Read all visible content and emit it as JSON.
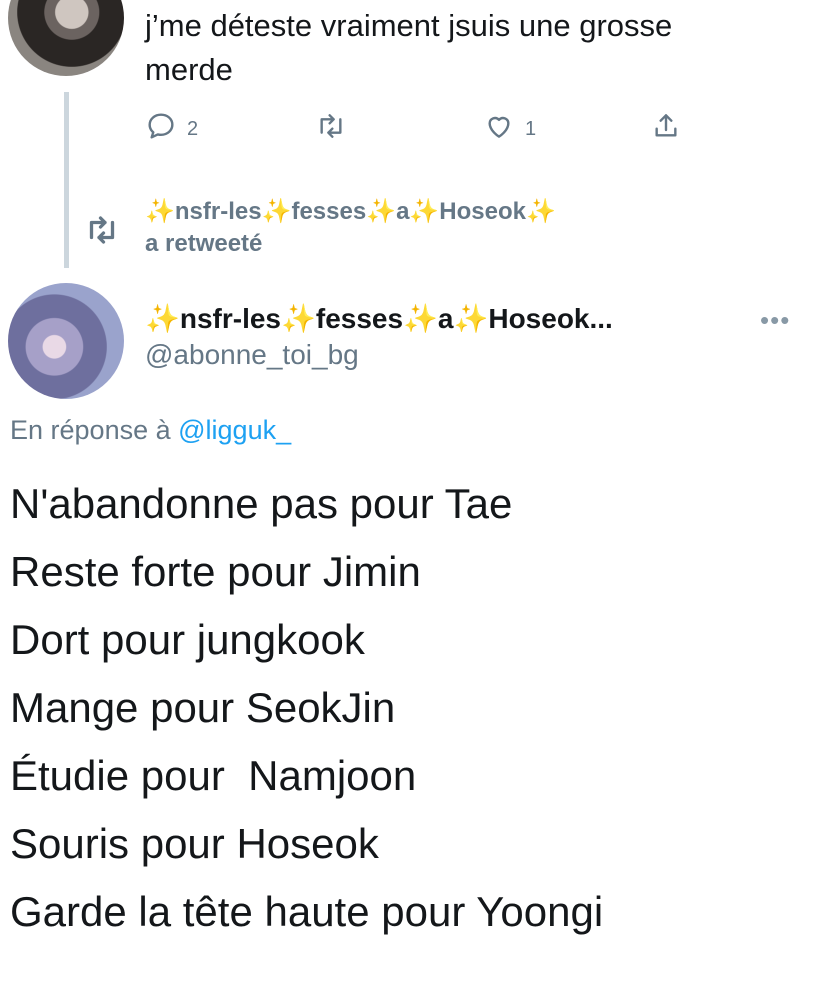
{
  "top_tweet": {
    "text_line1": "j’me déteste vraiment jsuis une grosse",
    "text_line2": "merde",
    "actions": {
      "reply_count": "2",
      "like_count": "1"
    }
  },
  "retweet": {
    "by_part1": "✨nsfr-les✨fesses✨a✨Hoseok✨",
    "by_part2": "a retweeté"
  },
  "main_tweet": {
    "author_name": "✨nsfr-les✨fesses✨a✨Hoseok...",
    "author_handle": "@abonne_toi_bg",
    "reply_prefix": "En réponse à ",
    "reply_handle": "@ligguk_",
    "lines": [
      "N'abandonne pas pour Tae",
      "Reste forte pour Jimin",
      "Dort pour jungkook",
      "Mange pour SeokJin",
      "Étudie pour  Namjoon",
      "Souris pour Hoseok",
      "Garde la tête haute pour Yoongi"
    ]
  },
  "icons": {
    "reply": "reply-icon",
    "retweet": "retweet-icon",
    "like": "heart-icon",
    "share": "share-icon",
    "more": "more-icon"
  }
}
